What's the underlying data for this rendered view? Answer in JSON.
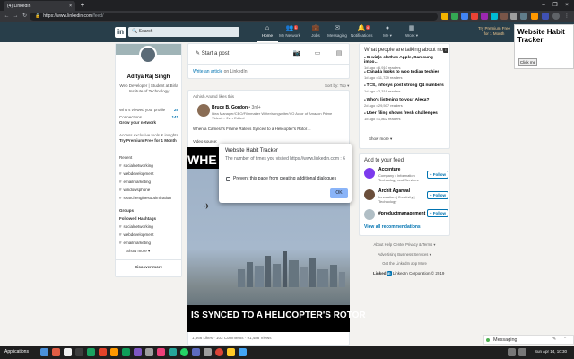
{
  "browser": {
    "tab_title": "(4) LinkedIn",
    "tab_close": "×",
    "new_tab": "+",
    "url_host": "https://www.linkedin.com",
    "url_path": "/feed/",
    "win_min": "–",
    "win_max": "❐",
    "win_close": "×"
  },
  "header": {
    "logo": "in",
    "search_placeholder": "Search",
    "nav": [
      {
        "label": "Home",
        "icon": "home-icon",
        "glyph": "⌂",
        "badge": ""
      },
      {
        "label": "My Network",
        "icon": "network-icon",
        "glyph": "👥",
        "badge": "1"
      },
      {
        "label": "Jobs",
        "icon": "jobs-icon",
        "glyph": "💼",
        "badge": ""
      },
      {
        "label": "Messaging",
        "icon": "messaging-icon",
        "glyph": "✉",
        "badge": ""
      },
      {
        "label": "Notifications",
        "icon": "bell-icon",
        "glyph": "🔔",
        "badge": "4"
      },
      {
        "label": "Me ▾",
        "icon": "me-icon",
        "glyph": "●",
        "badge": ""
      },
      {
        "label": "Work ▾",
        "icon": "work-icon",
        "glyph": "▦",
        "badge": ""
      }
    ],
    "premium_line1": "Try Premium Free",
    "premium_line2": "for 1 Month"
  },
  "profile": {
    "name": "Aditya Raj Singh",
    "headline": "Web Developer | Student at Birla Institute of Technology",
    "viewed_label": "Who's viewed your profile",
    "viewed_count": "25",
    "connections_label": "Connections",
    "connections_count": "141",
    "grow_network": "Grow your network",
    "premium_access": "Access exclusive tools & insights",
    "premium_offer": "Try Premium Free for 1 Month",
    "recent_label": "Recent",
    "recent": [
      "socialnetworking",
      "webdevelopment",
      "emailmarketing",
      "windowsphone",
      "searchenginesoptimization"
    ],
    "groups_label": "Groups",
    "hashtags_label": "Followed Hashtags",
    "hashtags": [
      "socialnetworking",
      "webdevelopment",
      "emailmarketing"
    ],
    "show_more": "Show more ▾",
    "discover_more": "Discover more"
  },
  "post_box": {
    "start_post": "Start a post",
    "write_article": "Write an article",
    "write_article_suffix": " on LinkedIn",
    "sort_by": "Sort by: Top ▾"
  },
  "feed_item": {
    "liked_this": "Ashish Anand likes this",
    "author": "Bruce B. Gordon",
    "author_degree": " • 3rd+",
    "author_sub": "Idea Manager/CEO/Filmmaker Writer/songwriter/VO Actor of Amazon Prime Video/… 2w • Edited",
    "text": "When a Camera's Frame Rate is Synced to a Helicopter's Rotor…",
    "video_label": "Video source:",
    "video_top": "WHE",
    "video_bottom": "IS SYNCED TO A HELICOPTER'S ROTOR",
    "helicopter": "✈",
    "stats": "1,666 Likes · 103 Comments · 91,488 Views"
  },
  "dialog": {
    "title": "Website Habit Tracker",
    "message": "The number of times you visited https://www.linkedin.com : 6",
    "checkbox_label": "Prevent this page from creating additional dialogues",
    "ok": "OK"
  },
  "news": {
    "title": "LinkedIn News",
    "headline": "What people are talking about now",
    "info": "i",
    "items": [
      {
        "title": "G-wiz(o clothes Apple, Samsung impo…",
        "meta": "1d ago • 6,910 readers"
      },
      {
        "title": "Canada looks to woo Indian techies",
        "meta": "1d ago • 11,729 readers"
      },
      {
        "title": "TCS, Infosys post strong Q4 numbers",
        "meta": "1d ago • 2,316 readers"
      },
      {
        "title": "Who's listening to your Alexa?",
        "meta": "2d ago • 29,507 readers"
      },
      {
        "title": "Uber filing shows fresh challenges",
        "meta": "1d ago • 1,862 readers"
      }
    ],
    "show_more": "Show more ▾"
  },
  "feed_add": {
    "title": "Add to your feed",
    "items": [
      {
        "name": "Accenture",
        "sub": "Company • Information Technology and Services",
        "btn": "+ Follow"
      },
      {
        "name": "Archit Agarwal",
        "sub": "Innovation | Creativity | Technology",
        "btn": "+ Follow"
      },
      {
        "name": "#productmanagement",
        "sub": "",
        "btn": "+ Follow"
      }
    ],
    "view_all": "View all recommendations"
  },
  "footer": {
    "row1": "About    Help Center    Privacy & Terms ▾",
    "row2": "Advertising    Business Services ▾",
    "row3": "Get the LinkedIn app    More",
    "brand": "Linked",
    "brand_in": "in",
    "copyright": " LinkedIn Corporation © 2019"
  },
  "extension_popup": {
    "title": "Website Habit Tracker",
    "button": "Click me"
  },
  "messaging": {
    "label": "Messaging"
  },
  "taskbar": {
    "apps": "Applications",
    "clock": "Sun Apr 14, 10:30"
  }
}
